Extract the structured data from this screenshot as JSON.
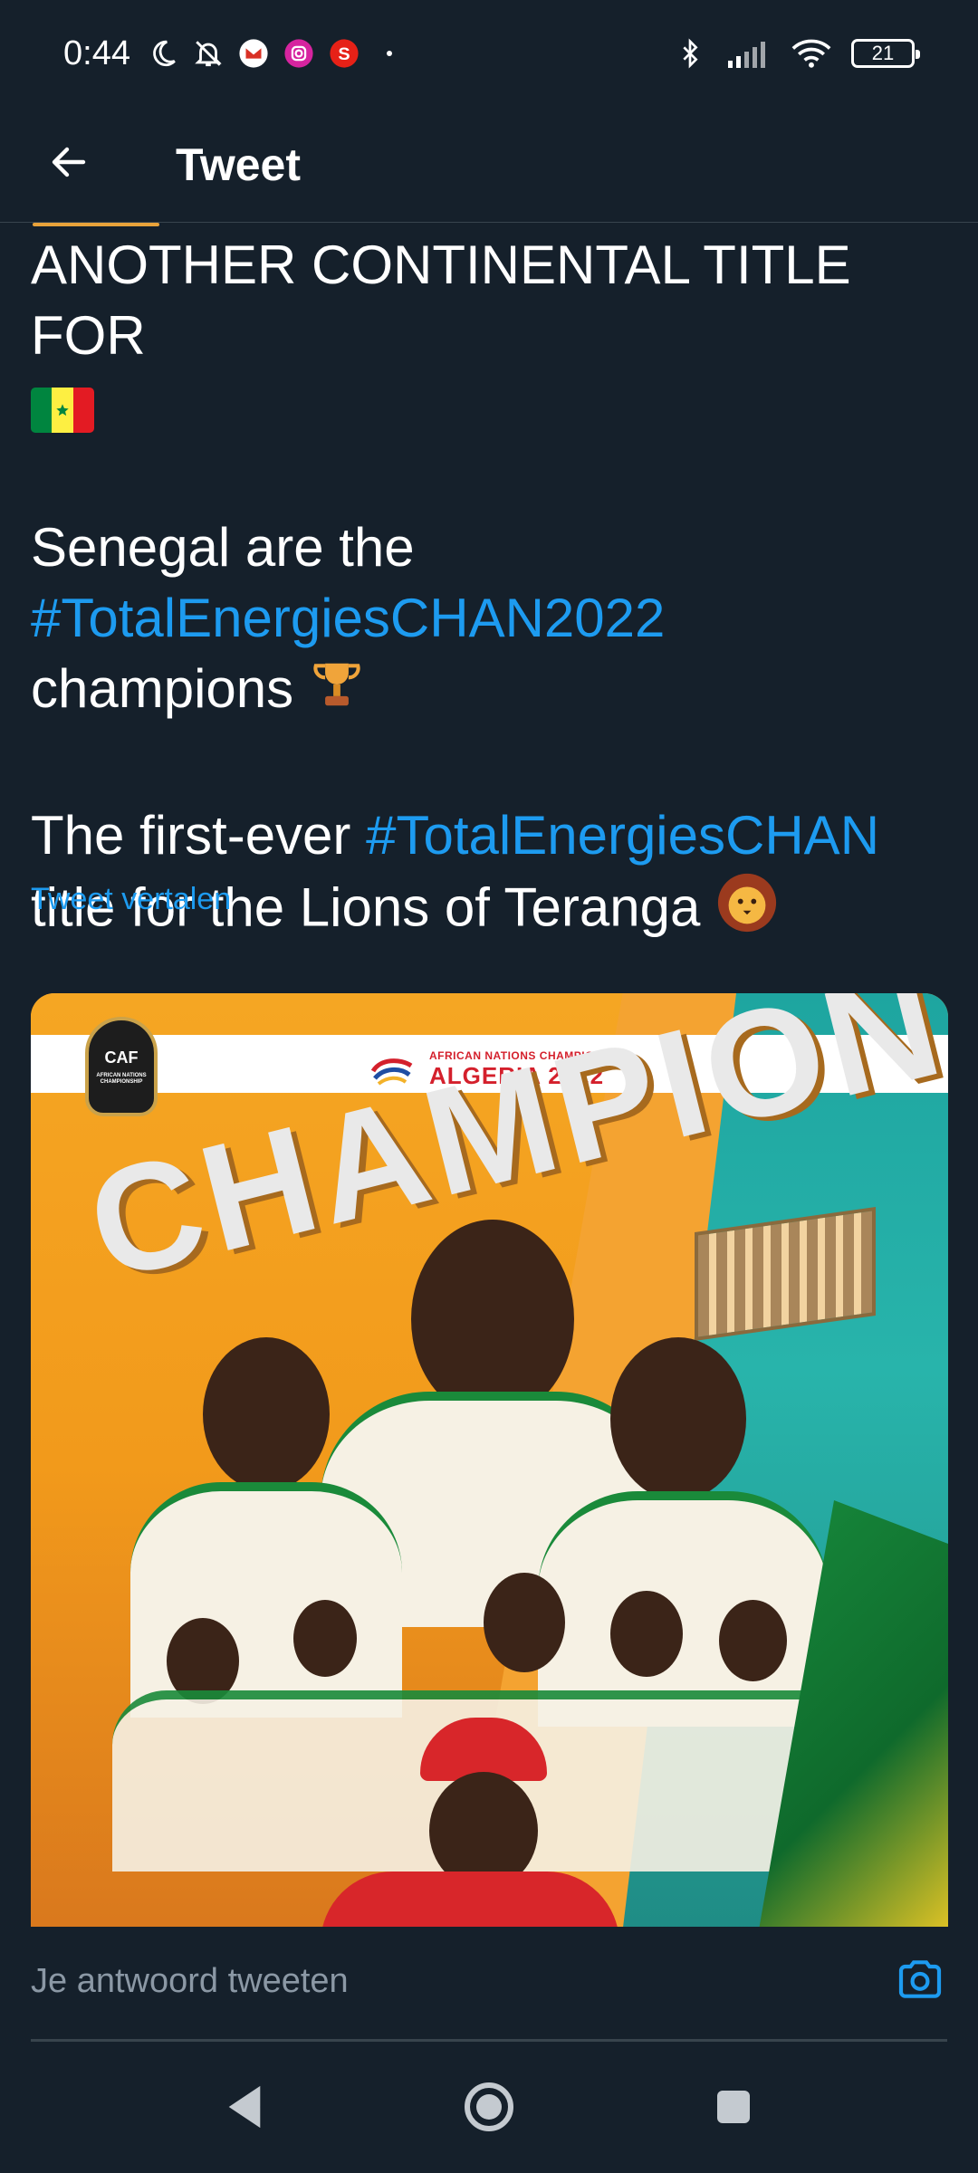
{
  "status_bar": {
    "time": "0:44",
    "battery": "21"
  },
  "header": {
    "title": "Tweet"
  },
  "tweet": {
    "line1": "ANOTHER CONTINENTAL TITLE FOR",
    "para2_prefix": "Senegal are the",
    "para2_hashtag": "#TotalEnergiesCHAN2022",
    "para2_suffix": "champions",
    "para3_prefix": "The first-ever",
    "para3_hashtag": "#TotalEnergiesCHAN",
    "para3_suffix": "title for the Lions of Teranga",
    "translate_label": "Tweet vertalen"
  },
  "media": {
    "banner_small": "AFRICAN NATIONS CHAMPIONSHIP",
    "banner_big": "ALGERIA 2022",
    "sponsor_name": "TotalEnergies",
    "badge_caf": "CAF",
    "badge_sub": "AFRICAN NATIONS CHAMPIONSHIP",
    "headline": "CHAMPIONS"
  },
  "reply": {
    "placeholder": "Je antwoord tweeten"
  },
  "colors": {
    "background": "#15202b",
    "link": "#1d9bf0",
    "muted": "#8b98a5"
  },
  "icons": {
    "back": "arrow-left-icon",
    "camera": "camera-icon",
    "nav_back": "triangle-back-icon",
    "nav_home": "circle-home-icon",
    "nav_recents": "square-recents-icon"
  }
}
